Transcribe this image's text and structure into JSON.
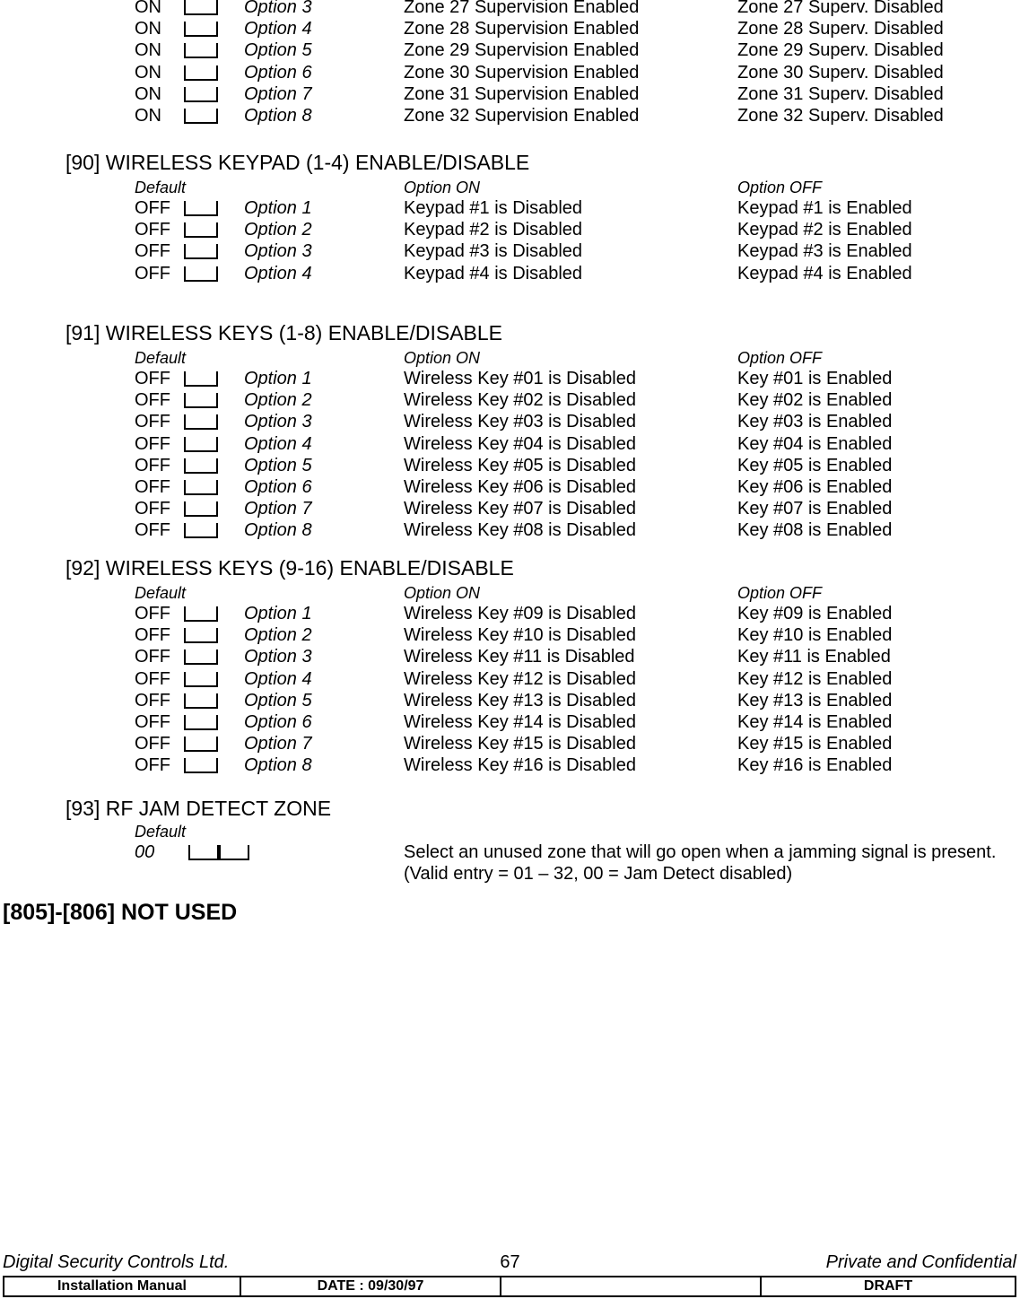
{
  "page": {
    "number": "67",
    "footer": {
      "company": "Digital Security Controls Ltd.",
      "confidential": "Private and Confidential",
      "table": {
        "manual": "Installation Manual",
        "date": "DATE :  09/30/97",
        "blank": "",
        "status": "DRAFT"
      }
    }
  },
  "continued_table": {
    "rows": [
      {
        "default": "ON",
        "box": "I___I",
        "option": "Option 3",
        "on": "Zone 27 Supervision Enabled",
        "off": "Zone 27 Superv. Disabled"
      },
      {
        "default": "ON",
        "box": "I___I",
        "option": "Option 4",
        "on": "Zone 28 Supervision Enabled",
        "off": "Zone 28 Superv. Disabled"
      },
      {
        "default": "ON",
        "box": "I___I",
        "option": "Option 5",
        "on": "Zone 29 Supervision Enabled",
        "off": "Zone 29 Superv. Disabled"
      },
      {
        "default": "ON",
        "box": "I___I",
        "option": "Option 6",
        "on": "Zone 30 Supervision Enabled",
        "off": "Zone 30 Superv. Disabled"
      },
      {
        "default": "ON",
        "box": "I___I",
        "option": "Option 7",
        "on": "Zone 31 Supervision Enabled",
        "off": "Zone 31 Superv. Disabled"
      },
      {
        "default": "ON",
        "box": "I___I",
        "option": "Option 8",
        "on": "Zone 32 Supervision Enabled",
        "off": "Zone 32 Superv. Disabled"
      }
    ]
  },
  "sections": [
    {
      "title": "[90] WIRELESS KEYPAD (1-4) ENABLE/DISABLE",
      "headers": {
        "default": "Default",
        "on": "Option ON",
        "off": "Option OFF"
      },
      "rows": [
        {
          "default": "OFF",
          "box": "I___I",
          "option": "Option 1",
          "on": "Keypad #1 is Disabled",
          "off": "Keypad #1 is Enabled"
        },
        {
          "default": "OFF",
          "box": "I___I",
          "option": "Option 2",
          "on": "Keypad #2 is Disabled",
          "off": "Keypad #2 is Enabled"
        },
        {
          "default": "OFF",
          "box": "I___I",
          "option": "Option 3",
          "on": "Keypad #3 is Disabled",
          "off": "Keypad #3 is Enabled"
        },
        {
          "default": "OFF",
          "box": "I___I",
          "option": "Option 4",
          "on": "Keypad #4 is Disabled",
          "off": "Keypad #4 is Enabled"
        }
      ]
    },
    {
      "title": "[91] WIRELESS KEYS (1-8) ENABLE/DISABLE",
      "headers": {
        "default": "Default",
        "on": "Option ON",
        "off": "Option OFF"
      },
      "rows": [
        {
          "default": "OFF",
          "box": "I___I",
          "option": "Option 1",
          "on": "Wireless Key #01 is Disabled",
          "off": "Key #01 is Enabled"
        },
        {
          "default": "OFF",
          "box": "I___I",
          "option": "Option 2",
          "on": "Wireless Key #02 is Disabled",
          "off": "Key #02 is Enabled"
        },
        {
          "default": "OFF",
          "box": "I___I",
          "option": "Option 3",
          "on": "Wireless Key #03 is Disabled",
          "off": "Key #03 is Enabled"
        },
        {
          "default": "OFF",
          "box": "I___I",
          "option": "Option 4",
          "on": "Wireless Key #04 is Disabled",
          "off": "Key #04 is Enabled"
        },
        {
          "default": "OFF",
          "box": "I___I",
          "option": "Option 5",
          "on": "Wireless Key #05 is Disabled",
          "off": "Key #05 is Enabled"
        },
        {
          "default": "OFF",
          "box": "I___I",
          "option": "Option 6",
          "on": "Wireless Key #06 is Disabled",
          "off": "Key #06 is Enabled"
        },
        {
          "default": "OFF",
          "box": "I___I",
          "option": "Option 7",
          "on": "Wireless Key #07 is Disabled",
          "off": "Key #07 is Enabled"
        },
        {
          "default": "OFF",
          "box": "I___I",
          "option": "Option 8",
          "on": "Wireless Key #08 is Disabled",
          "off": "Key #08 is Enabled"
        }
      ]
    },
    {
      "title": "[92] WIRELESS KEYS (9-16) ENABLE/DISABLE",
      "headers": {
        "default": "Default",
        "on": "Option ON",
        "off": "Option OFF"
      },
      "rows": [
        {
          "default": "OFF",
          "box": "I___I",
          "option": "Option 1",
          "on": "Wireless Key #09 is Disabled",
          "off": "Key #09 is Enabled"
        },
        {
          "default": "OFF",
          "box": "I___I",
          "option": "Option 2",
          "on": "Wireless Key #10 is Disabled",
          "off": "Key #10 is Enabled"
        },
        {
          "default": "OFF",
          "box": "I___I",
          "option": "Option 3",
          "on": "Wireless Key #11 is Disabled",
          "off": "Key #11 is Enabled"
        },
        {
          "default": "OFF",
          "box": "I___I",
          "option": "Option 4",
          "on": "Wireless Key #12 is Disabled",
          "off": "Key #12 is Enabled"
        },
        {
          "default": "OFF",
          "box": "I___I",
          "option": "Option 5",
          "on": "Wireless Key #13 is Disabled",
          "off": "Key #13 is Enabled"
        },
        {
          "default": "OFF",
          "box": "I___I",
          "option": "Option 6",
          "on": "Wireless Key #14 is Disabled",
          "off": "Key #14 is Enabled"
        },
        {
          "default": "OFF",
          "box": "I___I",
          "option": "Option 7",
          "on": "Wireless Key #15 is Disabled",
          "off": "Key #15 is Enabled"
        },
        {
          "default": "OFF",
          "box": "I___I",
          "option": "Option 8",
          "on": "Wireless Key #16 is Disabled",
          "off": "Key #16 is Enabled"
        }
      ]
    }
  ],
  "jam_section": {
    "title": "[93] RF JAM DETECT ZONE",
    "default_label": "Default",
    "default_value": "00",
    "box": "I___II___I",
    "description_line1": "Select an unused zone that will go open when a jamming signal is present.",
    "description_line2": "(Valid entry = 01 – 32, 00 = Jam Detect disabled)"
  },
  "not_used_heading": "[805]-[806] NOT USED"
}
